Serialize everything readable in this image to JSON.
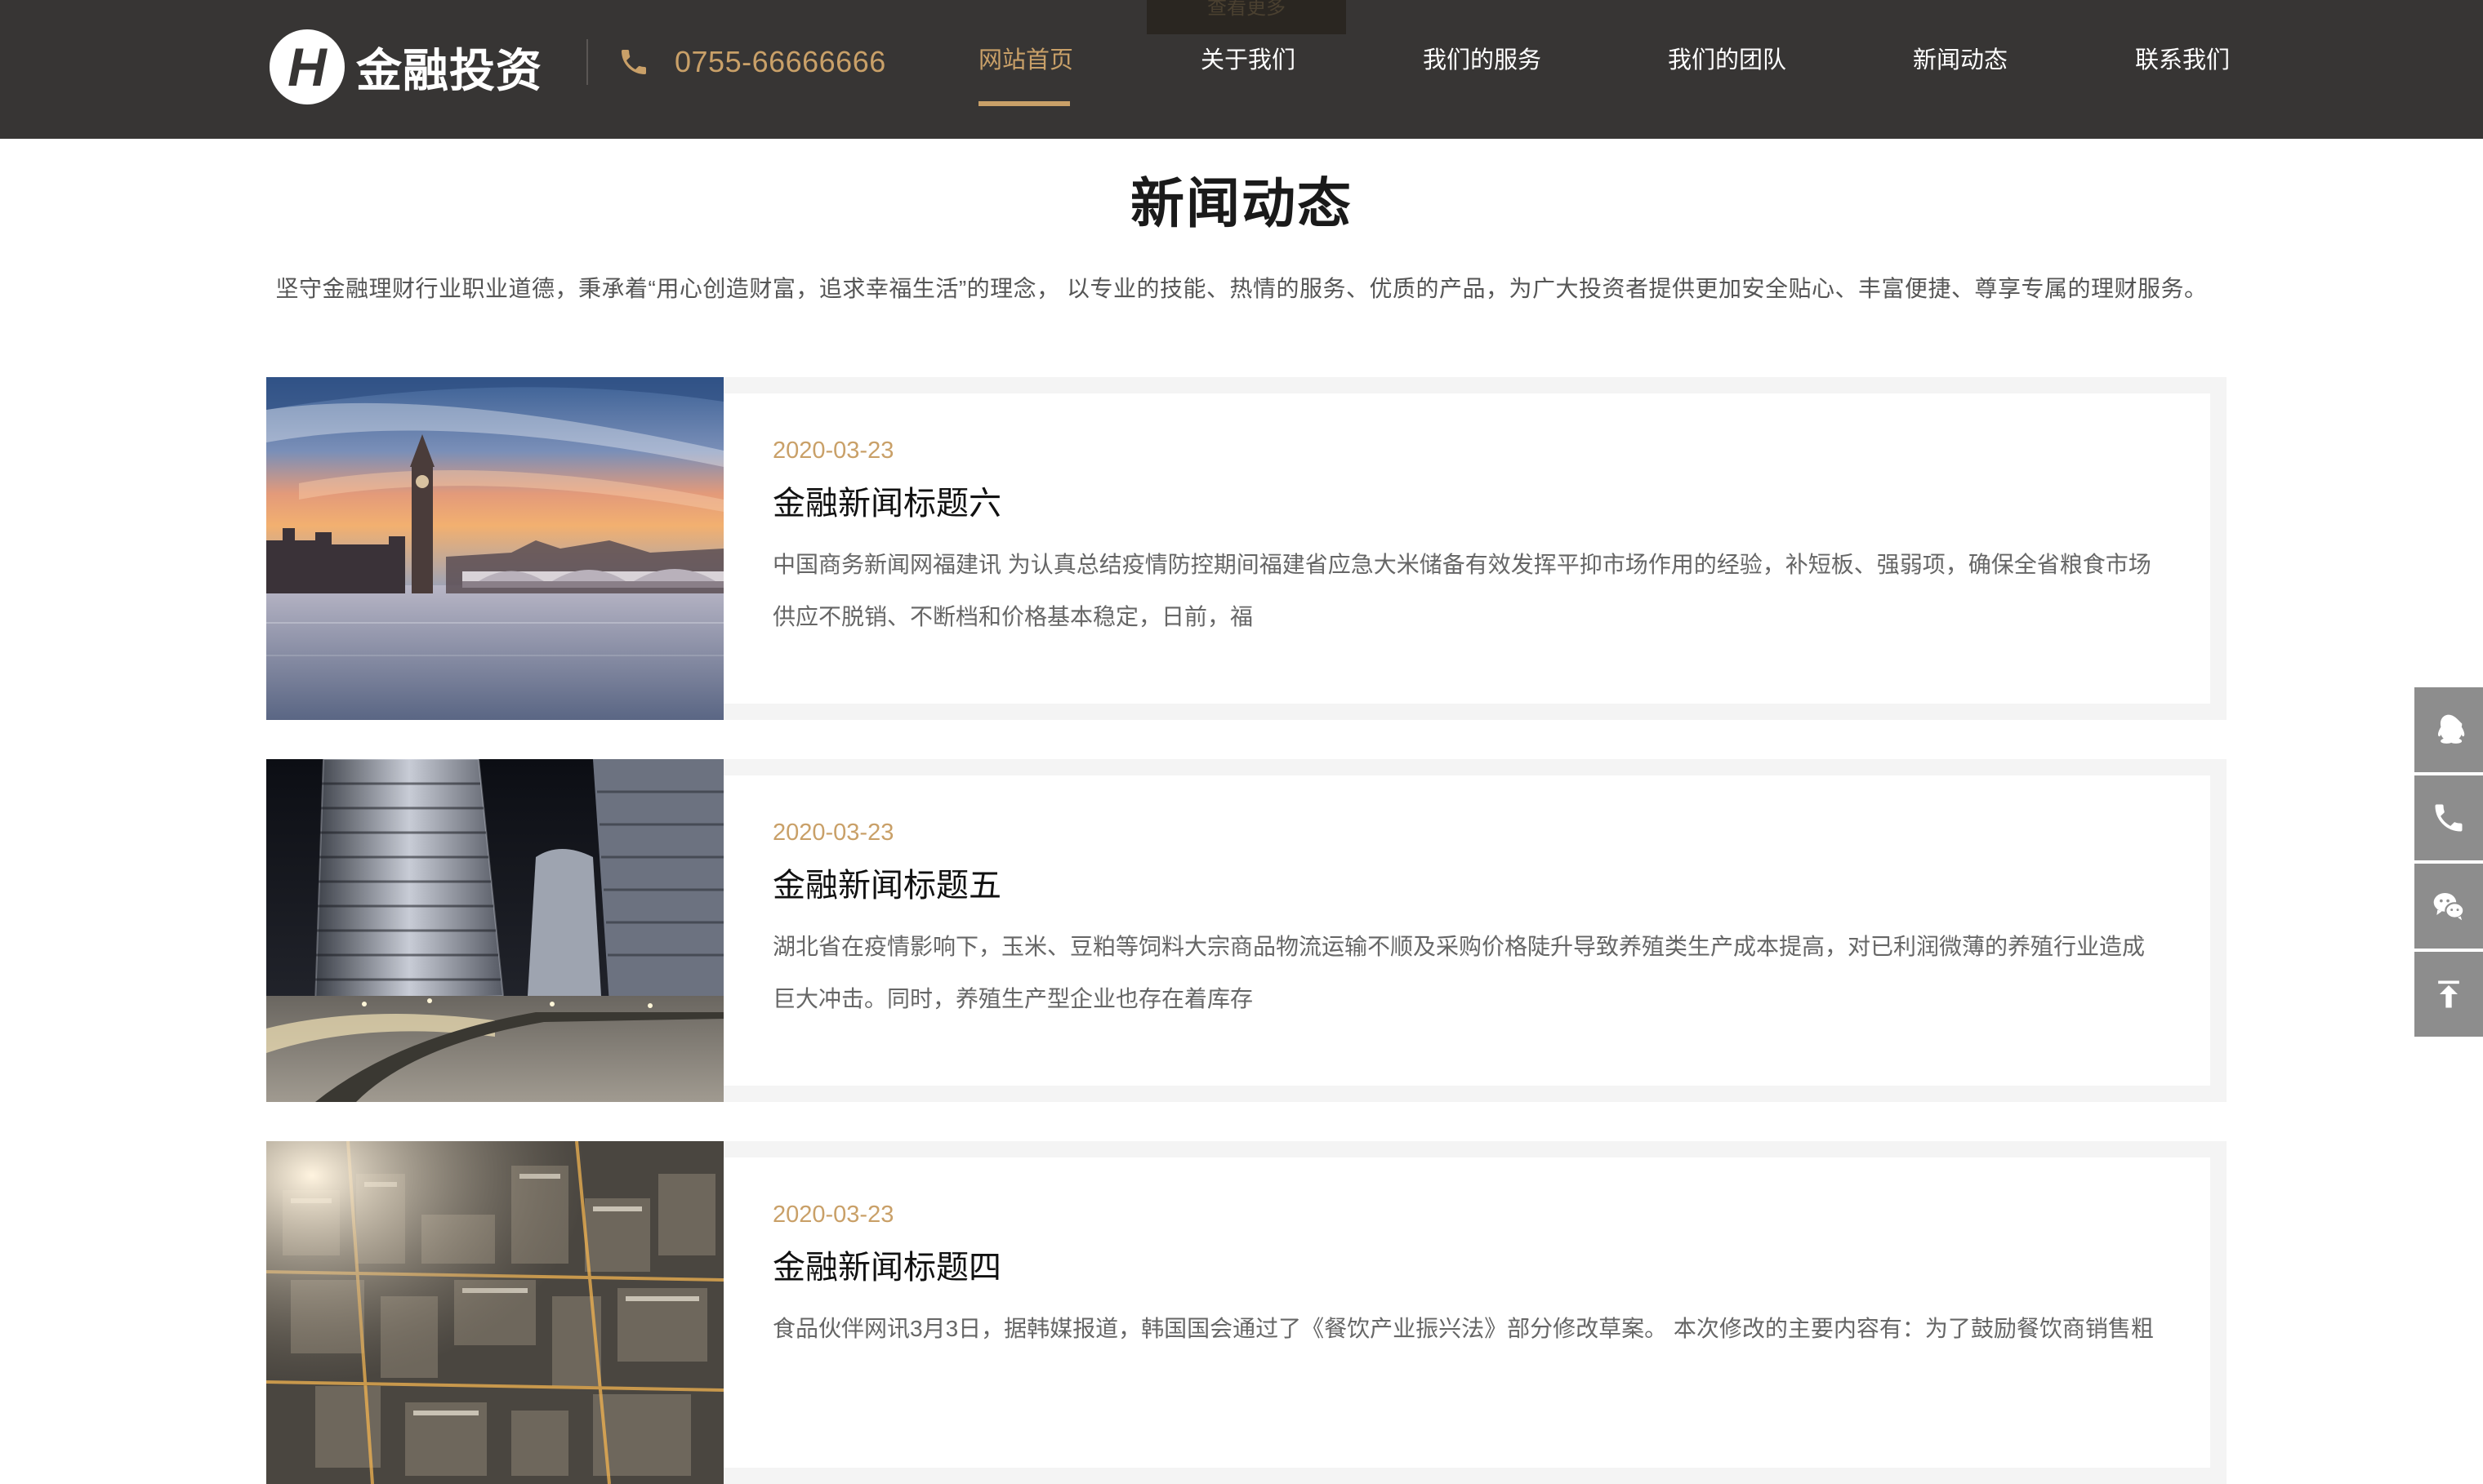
{
  "header": {
    "ghost_button_label": "查看更多",
    "logo_mark": "H",
    "logo_text": "金融投资",
    "phone_icon": "phone-icon",
    "phone": "0755-66666666",
    "nav": [
      {
        "label": "网站首页",
        "active": true
      },
      {
        "label": "关于我们",
        "active": false
      },
      {
        "label": "我们的服务",
        "active": false
      },
      {
        "label": "我们的团队",
        "active": false
      },
      {
        "label": "新闻动态",
        "active": false
      },
      {
        "label": "联系我们",
        "active": false
      }
    ]
  },
  "section": {
    "title": "新闻动态",
    "description": "坚守金融理财行业职业道德，秉承着“用心创造财富，追求幸福生活”的理念， 以专业的技能、热情的服务、优质的产品，为广大投资者提供更加安全贴心、丰富便捷、尊享专属的理财服务。"
  },
  "news": [
    {
      "date": "2020-03-23",
      "title": "金融新闻标题六",
      "excerpt_line1": "中国商务新闻网福建讯 为认真总结疫情防控期间福建省应急大米储备有效发挥平抑市场作用的经验，补短板、强弱项，确保全省粮食市场",
      "excerpt_line2": "供应不脱销、不断档和价格基本稳定，日前，福"
    },
    {
      "date": "2020-03-23",
      "title": "金融新闻标题五",
      "excerpt_line1": "湖北省在疫情影响下，玉米、豆粕等饲料大宗商品物流运输不顺及采购价格陡升导致养殖类生产成本提高，对已利润微薄的养殖行业造成",
      "excerpt_line2": "巨大冲击。同时，养殖生产型企业也存在着库存"
    },
    {
      "date": "2020-03-23",
      "title": "金融新闻标题四",
      "excerpt_line1": "食品伙伴网讯3月3日，据韩媒报道，韩国国会通过了《餐饮产业振兴法》部分修改草案。 本次修改的主要内容有：为了鼓励餐饮商销售粗",
      "excerpt_line2": ""
    }
  ],
  "side_bar": [
    {
      "icon": "qq-icon"
    },
    {
      "icon": "phone-icon"
    },
    {
      "icon": "wechat-icon"
    },
    {
      "icon": "back-to-top-icon"
    }
  ],
  "colors": {
    "header_bg": "#373534",
    "accent": "#c9a068",
    "card_bg": "#f4f4f4",
    "side_bar_bg": "#8d8d8d"
  }
}
